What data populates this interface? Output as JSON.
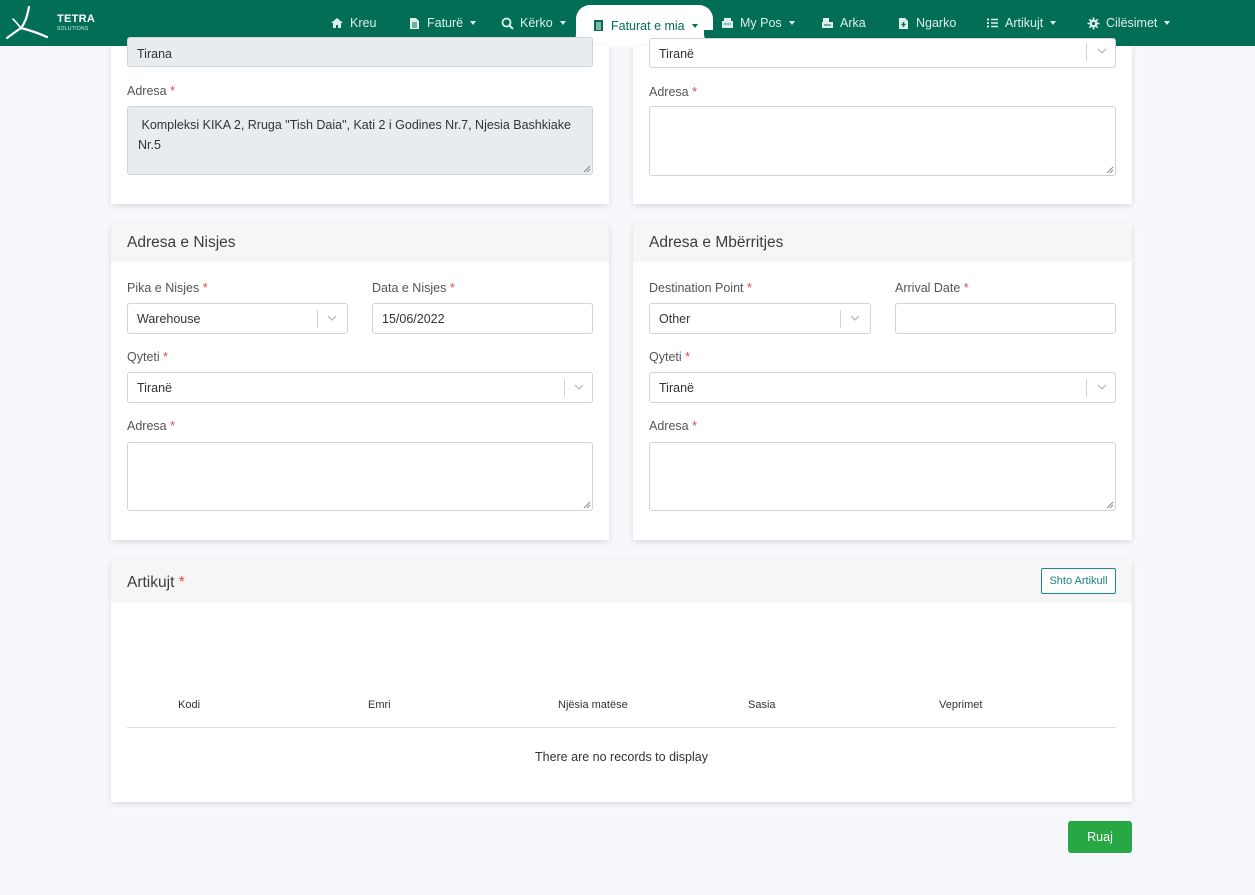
{
  "brand": {
    "name": "TETRA",
    "sub": "SOLUTIONS"
  },
  "nav": {
    "home": "Kreu",
    "invoice": "Faturë",
    "search": "Kërko",
    "my_invoices": "Faturat e mia",
    "my_pos": "My Pos",
    "cash": "Arka",
    "upload": "Ngarko",
    "items": "Artikujt",
    "settings": "Cilësimet"
  },
  "top_left": {
    "city_value": "Tirana",
    "address_label": "Adresa",
    "address_value": " Kompleksi KIKA 2, Rruga \"Tish Daia\", Kati 2 i Godines Nr.7, Njesia Bashkiake Nr.5"
  },
  "top_right": {
    "city_value": "Tiranë",
    "address_label": "Adresa",
    "address_value": ""
  },
  "departure": {
    "title": "Adresa e Nisjes",
    "point_label": "Pika e Nisjes",
    "point_value": "Warehouse",
    "date_label": "Data e Nisjes",
    "date_value": "15/06/2022",
    "city_label": "Qyteti",
    "city_value": "Tiranë",
    "address_label": "Adresa",
    "address_value": ""
  },
  "arrival": {
    "title": "Adresa e Mbërritjes",
    "point_label": "Destination Point",
    "point_value": "Other",
    "date_label": "Arrival Date",
    "date_value": "",
    "city_label": "Qyteti",
    "city_value": "Tiranë",
    "address_label": "Adresa",
    "address_value": ""
  },
  "items": {
    "title": "Artikujt",
    "add_button": "Shto Artikull",
    "columns": [
      "Kodi",
      "Emri",
      "Njësia matëse",
      "Sasia",
      "Veprimet"
    ],
    "empty": "There are no records to display"
  },
  "save_button": "Ruaj",
  "required_mark": "*",
  "colors": {
    "primary": "#036e56",
    "save": "#28a745",
    "required": "#e04848"
  }
}
